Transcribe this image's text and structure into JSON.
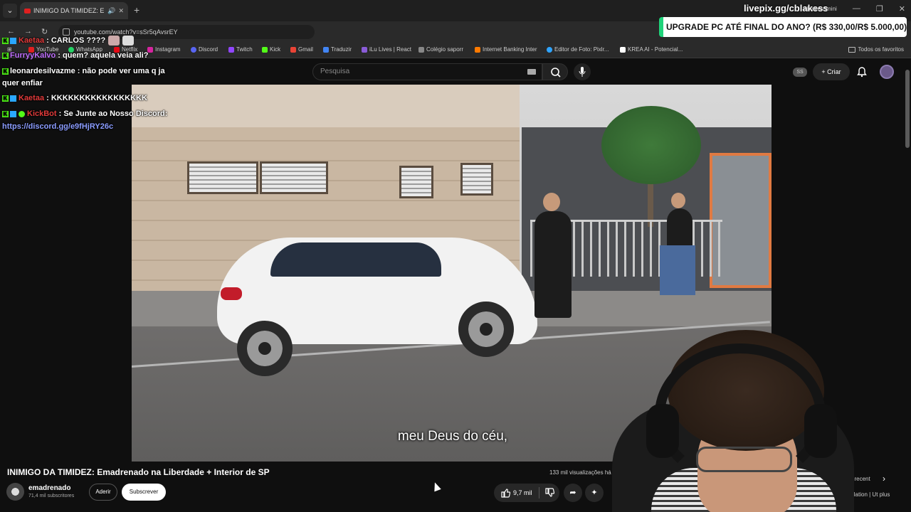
{
  "browser": {
    "tab_title": "INIMIGO DA TIMIDEZ: Ema",
    "url": "youtube.com/watch?v=sSr5qAvsrEY",
    "bookmarks": [
      "YouTube",
      "WhatsApp",
      "Netflix",
      "Instagram",
      "Discord",
      "Twitch",
      "Kick",
      "Gmail",
      "Traduzir",
      "iLu Lives | React",
      "Colégio saporr",
      "Internet Banking Inter",
      "Editor de Foto: Pixlr...",
      "KREA AI - Potencial..."
    ],
    "bookmarks_all": "Todos os favoritos"
  },
  "youtube": {
    "search_placeholder": "Pesquisa",
    "create_label": "Criar",
    "avatar_initials": "SS",
    "video_title": "INIMIGO DA TIMIDEZ: Emadrenado na Liberdade + Interior de SP",
    "views": "133 mil visualizações  há 2",
    "channel_name": "emadrenado",
    "channel_subs": "71,4 mil subscritores",
    "join_label": "Aderir",
    "subscribe_label": "Subscrever",
    "likes": "9,7 mil",
    "subtitle": "meu Deus do céu,",
    "side_recent": "ios recent",
    "side_installation": "llation | Ut plus"
  },
  "chat": [
    {
      "user": "Kaetaa",
      "color": "#e03a3a",
      "text": ": CARLOS ????"
    },
    {
      "user": "FurryyKalvo",
      "color": "#c070ff",
      "text": ": quem? aquela veia ali?"
    },
    {
      "user": "leonardesilvazme",
      "color": "#ffffff",
      "text": ": não pode ver uma q ja"
    },
    {
      "user": "",
      "color": "#ffffff",
      "text": "quer enfiar"
    },
    {
      "user": "Kaetaa",
      "color": "#e03a3a",
      "text": ": KKKKKKKKKKKKKKKKK"
    },
    {
      "user": "KickBot",
      "color": "#e03a3a",
      "text": ": Se Junte ao Nosso Discord:"
    },
    {
      "user": "",
      "color": "#8b9cff",
      "text": "https://discord.gg/e9fHjRY26c"
    }
  ],
  "overlay": {
    "livepix": "livepix.gg/cblakess",
    "livepix_sub": "cblakessmini",
    "upgrade_banner": "UPGRADE PC ATÉ FINAL DO ANO? (R$ 330,00/R$ 5.000,00)"
  },
  "colors": {
    "youtube_red": "#ff0000",
    "kick_green": "#53fc18",
    "banner_accent": "#1fd37a"
  }
}
